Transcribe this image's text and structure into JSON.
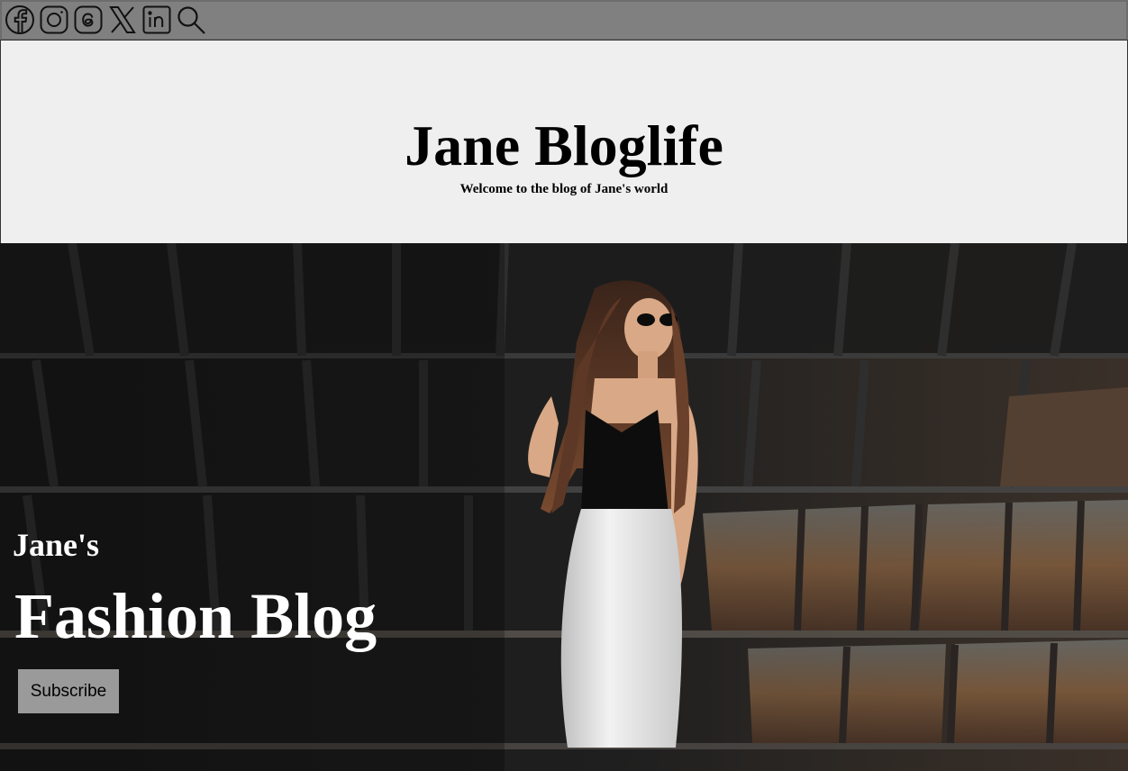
{
  "social_icons": [
    "facebook-icon",
    "instagram-icon",
    "threads-icon",
    "x-icon",
    "linkedin-icon",
    "search-icon"
  ],
  "header": {
    "title": "Jane Bloglife",
    "tagline": "Welcome to the blog of Jane's world"
  },
  "hero": {
    "kicker": "Jane's",
    "title": "Fashion Blog",
    "subscribe_label": "Subscribe"
  },
  "colors": {
    "topbar": "#808080",
    "header_bg": "#efefef",
    "button_bg": "#9a9a9a"
  }
}
